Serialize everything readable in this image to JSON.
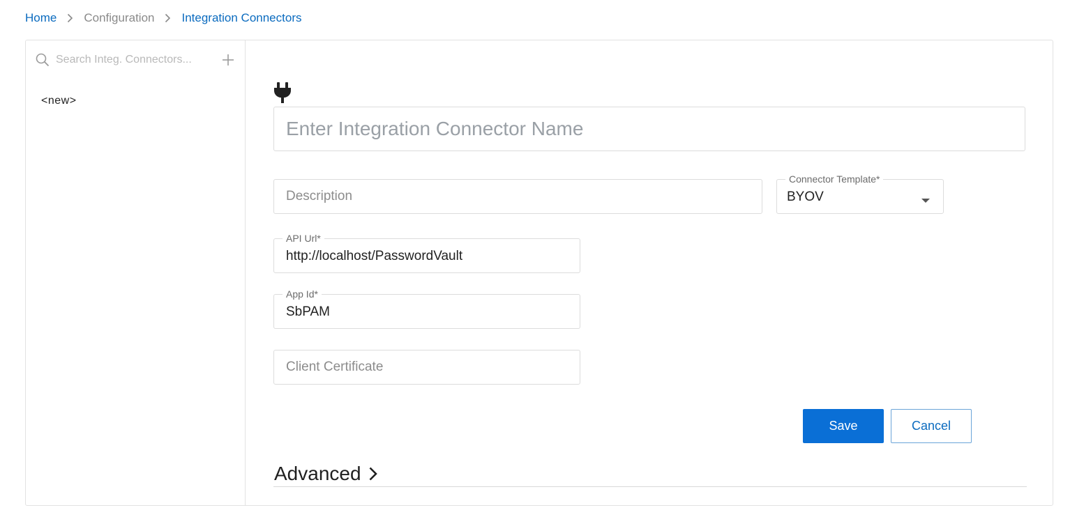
{
  "breadcrumb": {
    "home": "Home",
    "configuration": "Configuration",
    "current": "Integration Connectors"
  },
  "sidebar": {
    "search_placeholder": "Search Integ. Connectors...",
    "items": [
      {
        "label": "<new>"
      }
    ]
  },
  "form": {
    "name_placeholder": "Enter Integration Connector Name",
    "description_placeholder": "Description",
    "connector_template": {
      "label": "Connector Template*",
      "value": "BYOV"
    },
    "api_url": {
      "label": "API Url*",
      "value": "http://localhost/PasswordVault"
    },
    "app_id": {
      "label": "App Id*",
      "value": "SbPAM"
    },
    "client_certificate_placeholder": "Client Certificate",
    "save_label": "Save",
    "cancel_label": "Cancel",
    "advanced_label": "Advanced"
  },
  "colors": {
    "accent": "#0a6fd6",
    "link": "#0b6bbf",
    "border": "#dcdcdc"
  },
  "icons": [
    "search-icon",
    "plus-icon",
    "plug-icon",
    "caret-down-icon",
    "chevron-right-icon"
  ]
}
